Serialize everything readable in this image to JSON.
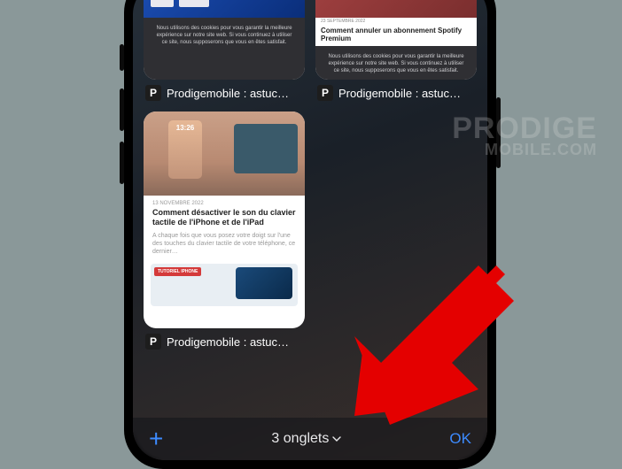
{
  "watermark": {
    "line1": "PRODIGE",
    "line2": "MOBILE.COM"
  },
  "tabs": [
    {
      "title": "Prodigemobile : astuc…",
      "cookie_text": "Nous utilisons des cookies pour vous garantir la meilleure expérience sur notre site web. Si vous continuez à utiliser ce site, nous supposerons que vous en êtes satisfait."
    },
    {
      "title": "Prodigemobile : astuc…",
      "article_date": "23 SEPTEMBRE 2022",
      "article_title": "Comment annuler un abonnement Spotify Premium",
      "cookie_text": "Nous utilisons des cookies pour vous garantir la meilleure expérience sur notre site web. Si vous continuez à utiliser ce site, nous supposerons que vous en êtes satisfait."
    },
    {
      "title": "Prodigemobile : astuc…",
      "lock_time": "13:26",
      "article_date": "13 NOVEMBRE 2022",
      "article_title": "Comment désactiver le son du clavier tactile de l'iPhone et de l'iPad",
      "article_body": "A chaque fois que vous posez votre doigt sur l'une des touches du clavier tactile de votre téléphone, ce dernier…",
      "bottom_tag": "TUTORIEL IPHONE"
    }
  ],
  "toolbar": {
    "plus_glyph": "+",
    "tab_count_label": "3 onglets",
    "ok_label": "OK"
  },
  "colors": {
    "accent": "#3d8bff",
    "arrow": "#e40000"
  }
}
